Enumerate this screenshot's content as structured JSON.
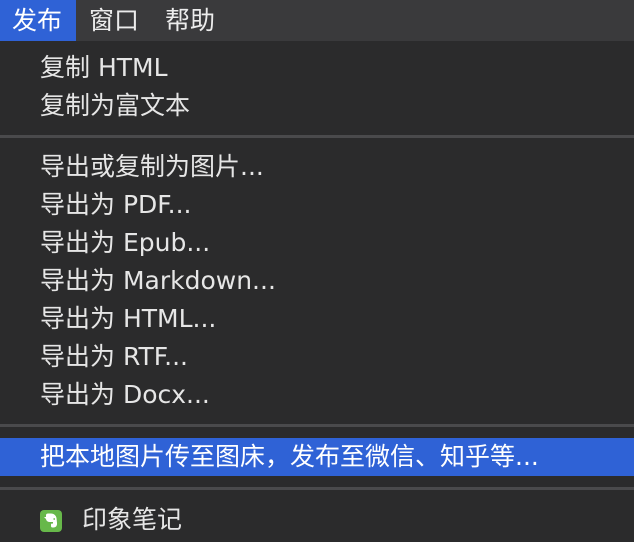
{
  "menubar": {
    "items": [
      {
        "label": "发布"
      },
      {
        "label": "窗口"
      },
      {
        "label": "帮助"
      }
    ]
  },
  "menu": {
    "copy_html": "复制 HTML",
    "copy_rich_text": "复制为富文本",
    "export_or_copy_image": "导出或复制为图片...",
    "export_pdf": "导出为 PDF...",
    "export_epub": "导出为 Epub...",
    "export_markdown": "导出为 Markdown...",
    "export_html": "导出为 HTML...",
    "export_rtf": "导出为 RTF...",
    "export_docx": "导出为 Docx...",
    "upload_and_publish": "把本地图片传至图床，发布至微信、知乎等...",
    "evernote": "印象笔记"
  },
  "icons": {
    "evernote": "evernote-elephant-icon"
  },
  "colors": {
    "highlight": "#2f62d6",
    "menu_bg": "#2b2b2c",
    "text": "#e6e6e6",
    "evernote_green": "#67b84a"
  }
}
